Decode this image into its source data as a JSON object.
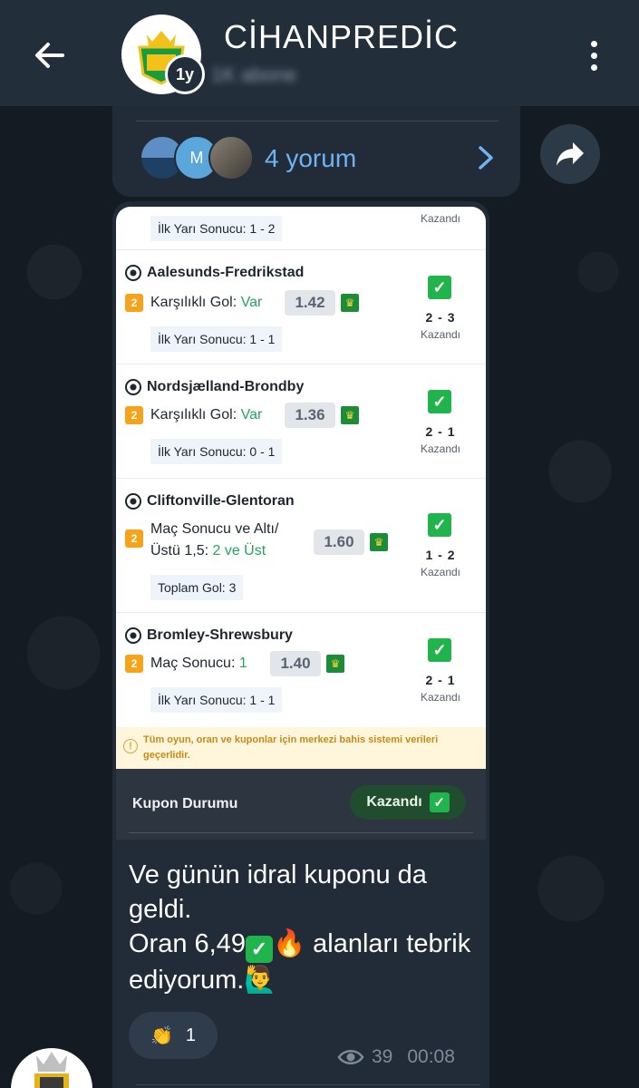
{
  "header": {
    "title": "CİHANPREDİC",
    "avatar_badge": "1y",
    "subscribers": "1K abone"
  },
  "comments": {
    "count_label": "4 yorum",
    "avatar_letter": "M"
  },
  "coupon": {
    "first_partial": {
      "sub_info": "İlk Yarı Sonucu: 1 - 2",
      "result_label": "Kazandı"
    },
    "matches": [
      {
        "teams": "Aalesunds-Fredrikstad",
        "badge": "2",
        "market": "Karşılıklı Gol:",
        "pick": "Var",
        "odds": "1.42",
        "sub_info": "İlk Yarı Sonucu: 1 - 1",
        "score": "2 - 3",
        "result_label": "Kazandı"
      },
      {
        "teams": "Nordsjælland-Brondby",
        "badge": "2",
        "market": "Karşılıklı Gol:",
        "pick": "Var",
        "odds": "1.36",
        "sub_info": "İlk Yarı Sonucu: 0 - 1",
        "score": "2 - 1",
        "result_label": "Kazandı"
      },
      {
        "teams": "Cliftonville-Glentoran",
        "badge": "2",
        "market_line1": "Maç Sonucu ve Altı/",
        "market_line2": "Üstü 1,5:",
        "pick": "2 ve Üst",
        "odds": "1.60",
        "sub_info": "Toplam Gol: 3",
        "score": "1 - 2",
        "result_label": "Kazandı"
      },
      {
        "teams": "Bromley-Shrewsbury",
        "badge": "2",
        "market": "Maç Sonucu:",
        "pick": "1",
        "odds": "1.40",
        "sub_info": "İlk Yarı Sonucu: 1 - 1",
        "score": "2 - 1",
        "result_label": "Kazandı"
      }
    ],
    "warning": "Tüm oyun, oran ve kuponlar için merkezi bahis sistemi verileri geçerlidir.",
    "status_label": "Kupon Durumu",
    "status_value": "Kazandı"
  },
  "message": {
    "line1": "Ve günün idral kuponu da geldi.",
    "line2_prefix": "Oran 6,49",
    "line2_suffix": "🔥 alanları tebrik ediyorum.🙋‍♂️",
    "reaction_emoji": "👏",
    "reaction_count": "1",
    "views": "39",
    "time": "00:08"
  },
  "colors": {
    "header_bg": "#232e3b",
    "bubble_bg": "#222c38",
    "link_blue": "#6eb4f2",
    "win_green": "#21b34c",
    "pick_green": "#21a55f",
    "badge_orange": "#f5a31a"
  }
}
